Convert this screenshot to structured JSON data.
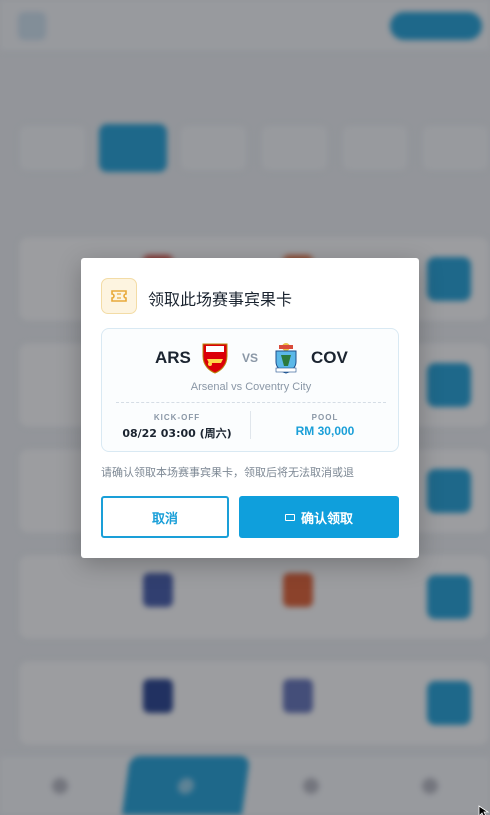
{
  "modal": {
    "title": "领取此场赛事宾果卡",
    "icon": "ticket-icon",
    "match": {
      "home_code": "ARS",
      "away_code": "COV",
      "vs": "VS",
      "name": "Arsenal vs Coventry City",
      "kickoff_label": "KICK-OFF",
      "kickoff_value": "08/22 03:00 (周六)",
      "pool_label": "POOL",
      "pool_value": "RM 30,000"
    },
    "confirm_text": "请确认领取本场赛事宾果卡，领取后将无法取消或退",
    "cancel_label": "取消",
    "confirm_label": "确认领取"
  },
  "colors": {
    "accent": "#0f9fdc",
    "overlay": "rgba(35,38,44,0.45)",
    "icon_bg": "#fdf4e0",
    "arsenal_red": "#db0007",
    "coventry_blue": "#5bb8e8"
  }
}
